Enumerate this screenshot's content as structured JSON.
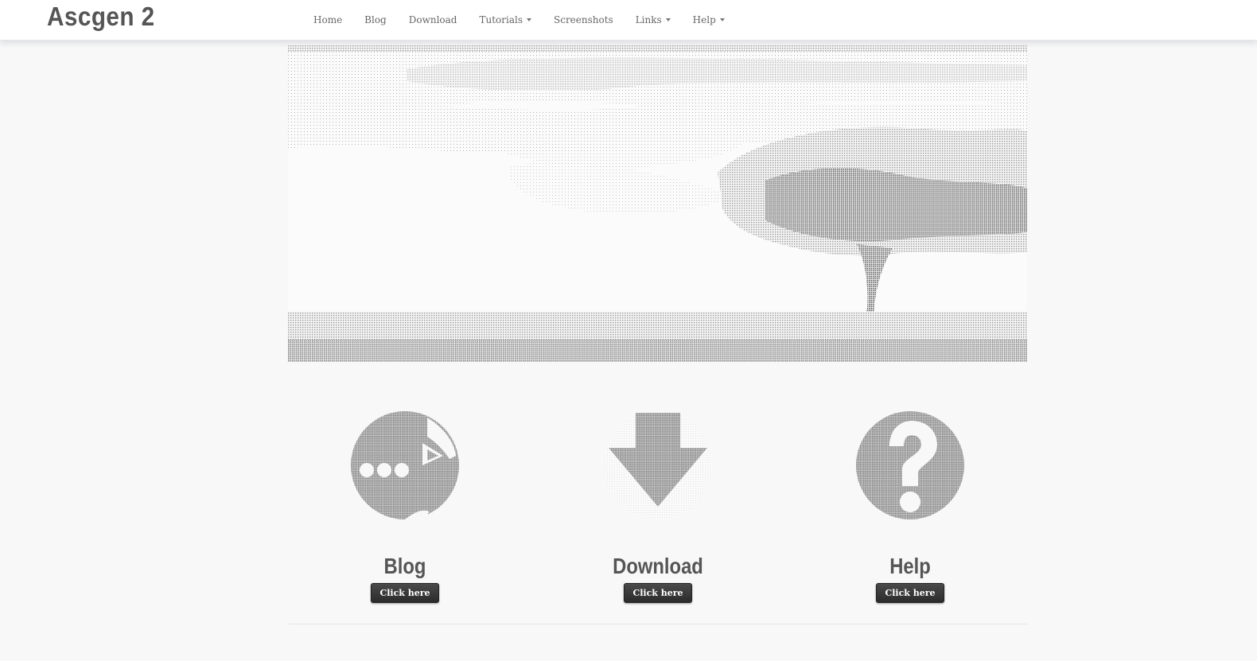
{
  "brand": "Ascgen 2",
  "nav": [
    {
      "label": "Home",
      "dropdown": false
    },
    {
      "label": "Blog",
      "dropdown": false
    },
    {
      "label": "Download",
      "dropdown": false
    },
    {
      "label": "Tutorials",
      "dropdown": true
    },
    {
      "label": "Screenshots",
      "dropdown": false
    },
    {
      "label": "Links",
      "dropdown": true
    },
    {
      "label": "Help",
      "dropdown": true
    }
  ],
  "features": [
    {
      "title": "Blog",
      "button": "Click here",
      "icon": "chat-bubble-icon"
    },
    {
      "title": "Download",
      "button": "Click here",
      "icon": "download-arrow-icon"
    },
    {
      "title": "Help",
      "button": "Click here",
      "icon": "question-mark-icon"
    }
  ],
  "colors": {
    "ascii_gray": "#8a8a8a",
    "button_dark": "#333333",
    "background": "#f8f8f8"
  }
}
